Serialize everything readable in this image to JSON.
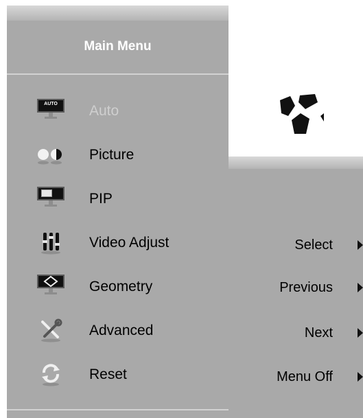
{
  "menu": {
    "title": "Main Menu",
    "items": [
      {
        "label": "Auto",
        "icon": "auto-monitor-icon",
        "enabled": false
      },
      {
        "label": "Picture",
        "icon": "brightness-contrast-icon",
        "enabled": true
      },
      {
        "label": "PIP",
        "icon": "pip-monitor-icon",
        "enabled": true
      },
      {
        "label": "Video Adjust",
        "icon": "color-sliders-icon",
        "enabled": true
      },
      {
        "label": "Geometry",
        "icon": "geometry-monitor-icon",
        "enabled": true
      },
      {
        "label": "Advanced",
        "icon": "wrench-screwdriver-icon",
        "enabled": true
      },
      {
        "label": "Reset",
        "icon": "reset-arrows-icon",
        "enabled": true
      }
    ],
    "auto_icon_text": "AUTO"
  },
  "buttons": [
    {
      "label": "Select"
    },
    {
      "label": "Previous"
    },
    {
      "label": "Next"
    },
    {
      "label": "Menu Off"
    }
  ],
  "colors": {
    "panel": "#a9a9a9",
    "title_text": "#ffffff",
    "disabled_text": "#cfcfcf"
  }
}
